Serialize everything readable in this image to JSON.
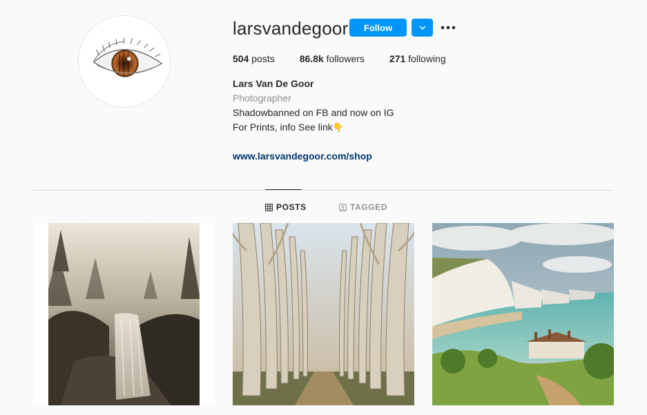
{
  "profile": {
    "username": "larsvandegoor",
    "follow_label": "Follow",
    "avatar_icon": "eye-avatar-icon",
    "stats": {
      "posts_count": "504",
      "posts_label": " posts",
      "followers_count": "86.8k",
      "followers_label": " followers",
      "following_count": "271",
      "following_label": " following"
    },
    "full_name": "Lars Van De Goor",
    "category": "Photographer",
    "bio_line_1": "Shadowbanned on FB and now on IG",
    "bio_line_2": "For Prints, info See link",
    "bio_emoji": "👇",
    "website": "www.larsvandegoor.com/shop"
  },
  "tabs": [
    {
      "label": "POSTS",
      "icon": "grid-icon",
      "active": true
    },
    {
      "label": "TAGGED",
      "icon": "tagged-icon",
      "active": false
    }
  ],
  "colors": {
    "accent": "#0095f6",
    "background": "#fafafa",
    "link": "#00376b",
    "muted": "#8e8e8e",
    "text": "#262626"
  },
  "posts": [
    {
      "subject": "waterfall-forest-photo"
    },
    {
      "subject": "tree-avenue-photo"
    },
    {
      "subject": "white-cliffs-coast-photo"
    }
  ]
}
